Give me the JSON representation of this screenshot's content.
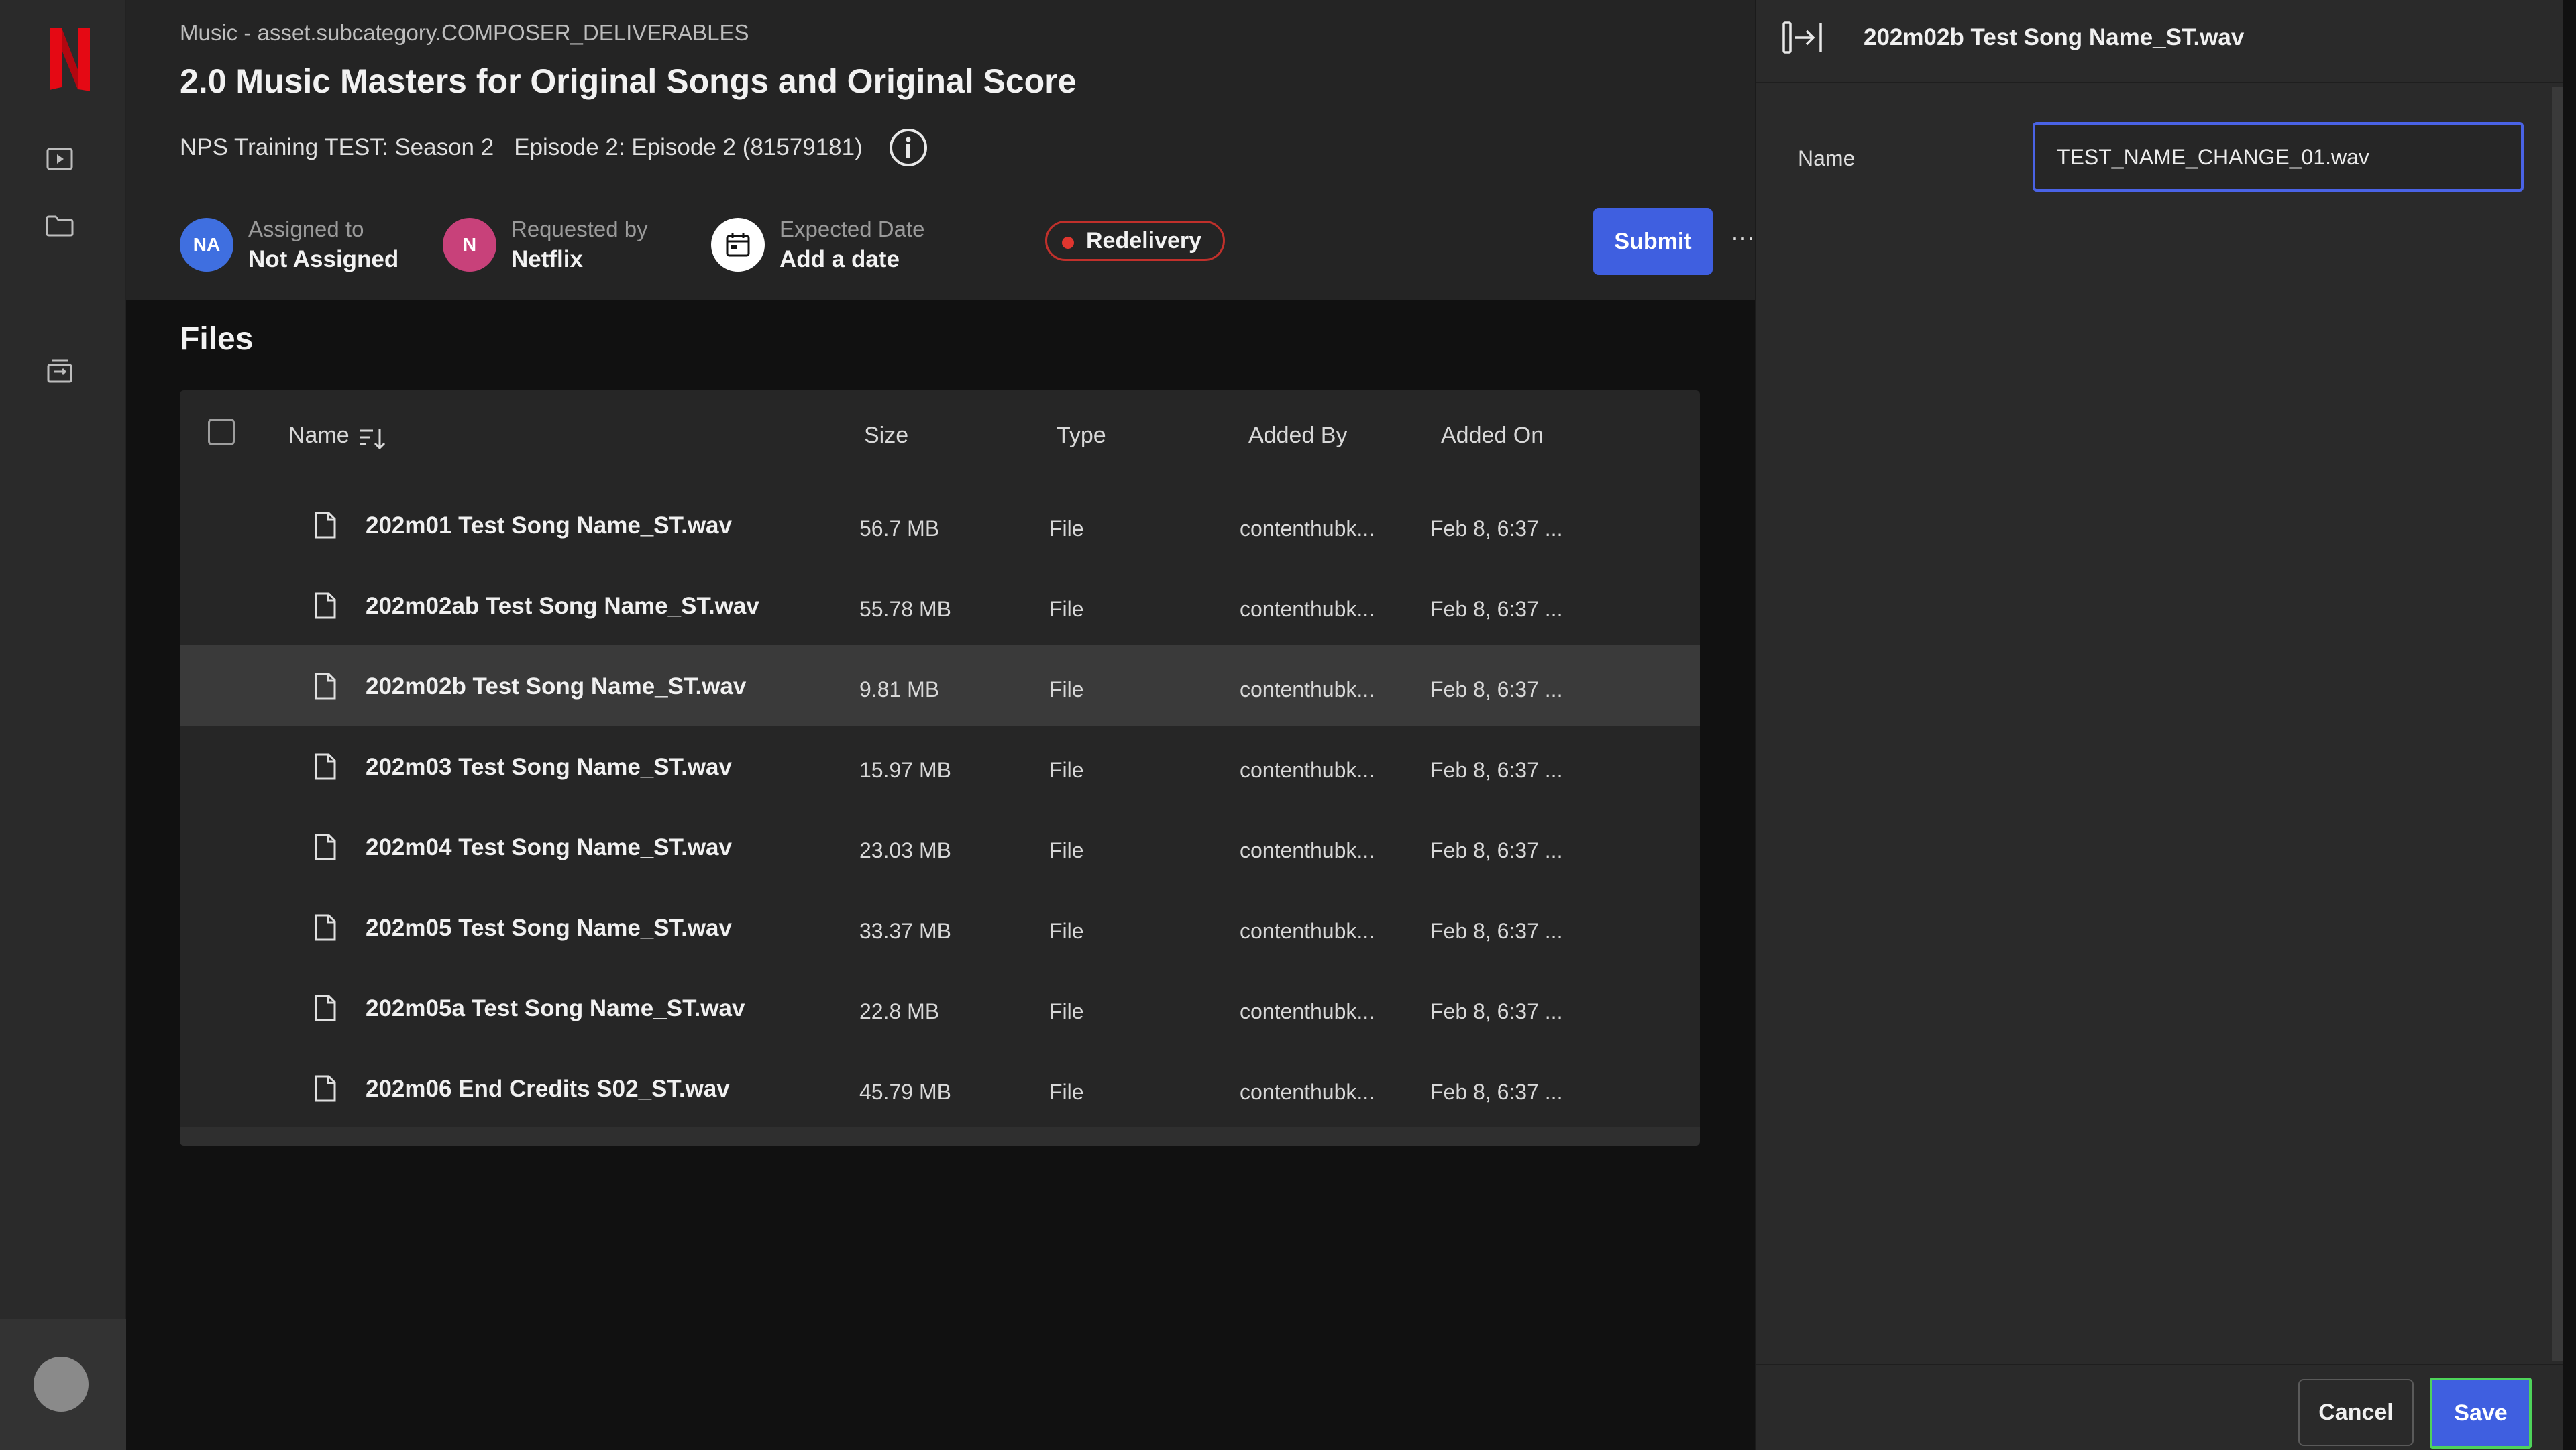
{
  "app": {
    "brand_color": "#e50914",
    "accent_color": "#3f5fe0",
    "logo_letter": "N"
  },
  "rail": {
    "icons": [
      "play-icon",
      "folder-icon",
      "archive-icon"
    ]
  },
  "header": {
    "subcategory": "Music - asset.subcategory.COMPOSER_DELIVERABLES",
    "title": "2.0 Music Masters for Original Songs and Original Score",
    "show": "NPS Training TEST: Season 2",
    "episode": "Episode 2: Episode 2 (81579181)",
    "assigned": {
      "initials": "NA",
      "label": "Assigned to",
      "value": "Not Assigned",
      "color": "#3f6fe0"
    },
    "requested": {
      "initials": "N",
      "label": "Requested by",
      "value": "Netflix",
      "color": "#c8417a"
    },
    "expected": {
      "label": "Expected Date",
      "value": "Add a date"
    },
    "status_badge": "Redelivery",
    "submit_label": "Submit",
    "more_label": "···"
  },
  "files": {
    "title": "Files",
    "columns": {
      "name": "Name",
      "size": "Size",
      "type": "Type",
      "added_by": "Added By",
      "added_on": "Added On"
    },
    "rows": [
      {
        "name": "202m01 Test Song Name_ST.wav",
        "size": "56.7 MB",
        "type": "File",
        "added_by": "contenthubk...",
        "added_on": "Feb 8, 6:37 ..."
      },
      {
        "name": "202m02ab Test Song Name_ST.wav",
        "size": "55.78 MB",
        "type": "File",
        "added_by": "contenthubk...",
        "added_on": "Feb 8, 6:37 ..."
      },
      {
        "name": "202m02b Test Song Name_ST.wav",
        "size": "9.81 MB",
        "type": "File",
        "added_by": "contenthubk...",
        "added_on": "Feb 8, 6:37 ..."
      },
      {
        "name": "202m03 Test Song Name_ST.wav",
        "size": "15.97 MB",
        "type": "File",
        "added_by": "contenthubk...",
        "added_on": "Feb 8, 6:37 ..."
      },
      {
        "name": "202m04 Test Song Name_ST.wav",
        "size": "23.03 MB",
        "type": "File",
        "added_by": "contenthubk...",
        "added_on": "Feb 8, 6:37 ..."
      },
      {
        "name": "202m05 Test Song Name_ST.wav",
        "size": "33.37 MB",
        "type": "File",
        "added_by": "contenthubk...",
        "added_on": "Feb 8, 6:37 ..."
      },
      {
        "name": "202m05a Test Song Name_ST.wav",
        "size": "22.8 MB",
        "type": "File",
        "added_by": "contenthubk...",
        "added_on": "Feb 8, 6:37 ..."
      },
      {
        "name": "202m06 End Credits S02_ST.wav",
        "size": "45.79 MB",
        "type": "File",
        "added_by": "contenthubk...",
        "added_on": "Feb 8, 6:37 ..."
      }
    ],
    "selected_index": 2
  },
  "panel": {
    "title": "202m02b Test Song Name_ST.wav",
    "field_label": "Name",
    "field_value": "TEST_NAME_CHANGE_01.wav",
    "cancel_label": "Cancel",
    "save_label": "Save"
  }
}
